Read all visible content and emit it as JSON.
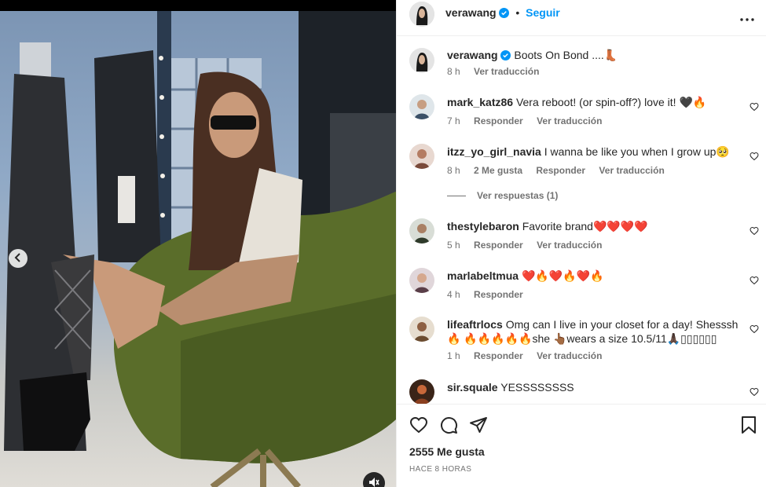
{
  "header": {
    "username": "verawang",
    "separator": "•",
    "follow_label": "Seguir"
  },
  "caption": {
    "username": "verawang",
    "text": "Boots On Bond ....👢",
    "time": "8 h",
    "translate": "Ver traducción"
  },
  "comments": [
    {
      "username": "mark_katz86",
      "text": "Vera reboot! (or spin-off?) love it! 🖤🔥",
      "time": "7 h",
      "likes": "",
      "reply": "Responder",
      "translate": "Ver traducción"
    },
    {
      "username": "itzz_yo_girl_navia",
      "text": "I wanna be like you when I grow up🥺",
      "time": "8 h",
      "likes": "2 Me gusta",
      "reply": "Responder",
      "translate": "Ver traducción"
    },
    {
      "username": "thestylebaron",
      "text": "Favorite brand❤️❤️❤️❤️",
      "time": "5 h",
      "likes": "",
      "reply": "Responder",
      "translate": "Ver traducción"
    },
    {
      "username": "marlabeltmua",
      "text": "❤️🔥❤️🔥❤️🔥",
      "time": "4 h",
      "likes": "",
      "reply": "Responder",
      "translate": ""
    },
    {
      "username": "lifeaftrlocs",
      "text": "Omg can I live in your closet for a day! Shesssh 🔥 🔥🔥🔥🔥🔥she 👆🏾wears a size 10.5/11🙏🏿▯▯▯▯▯▯",
      "time": "1 h",
      "likes": "",
      "reply": "Responder",
      "translate": "Ver traducción"
    },
    {
      "username": "sir.squale",
      "text": "YESSSSSSSS",
      "time": "",
      "likes": "",
      "reply": "",
      "translate": ""
    }
  ],
  "view_replies": "Ver respuestas (1)",
  "likes_count": "2555 Me gusta",
  "posted_ago": "HACE 8 HORAS",
  "colors": {
    "accent": "#0095f6",
    "verified": "#0095f6",
    "muted": "#737373"
  },
  "icons": [
    "chevron-left-icon",
    "mute-icon",
    "verified-icon",
    "more-icon",
    "heart-icon",
    "comment-icon",
    "share-icon",
    "bookmark-icon"
  ]
}
